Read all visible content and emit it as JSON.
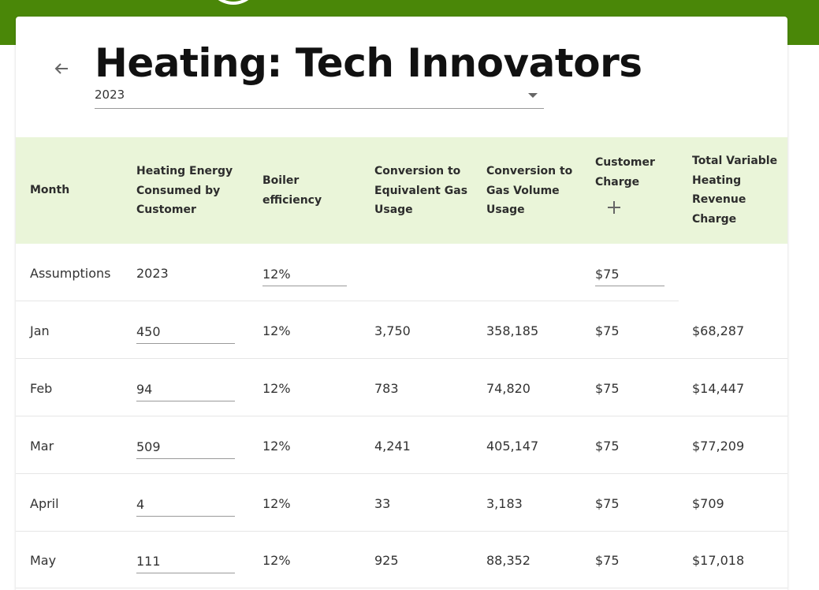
{
  "page": {
    "title": "Heating: Tech Innovators"
  },
  "year_select": {
    "value": "2023"
  },
  "table": {
    "headers": {
      "month": "Month",
      "energy": [
        "Heating Energy",
        "Consumed by",
        "Customer"
      ],
      "boiler": [
        "Boiler",
        "efficiency"
      ],
      "equiv": [
        "Conversion to",
        "Equivalent Gas",
        "Usage"
      ],
      "volume": [
        "Conversion to",
        "Gas Volume",
        "Usage"
      ],
      "charge": [
        "Customer",
        "Charge"
      ],
      "total": [
        "Total Variable",
        "Heating",
        "Revenue",
        "Charge"
      ]
    },
    "assumptions": {
      "label": "Assumptions",
      "year": "2023",
      "boiler": "12%",
      "charge": "$75"
    },
    "rows": [
      {
        "month": "Jan",
        "energy": "450",
        "boiler": "12%",
        "equiv": "3,750",
        "volume": "358,185",
        "charge": "$75",
        "total": "$68,287"
      },
      {
        "month": "Feb",
        "energy": "94",
        "boiler": "12%",
        "equiv": "783",
        "volume": "74,820",
        "charge": "$75",
        "total": "$14,447"
      },
      {
        "month": "Mar",
        "energy": "509",
        "boiler": "12%",
        "equiv": "4,241",
        "volume": "405,147",
        "charge": "$75",
        "total": "$77,209"
      },
      {
        "month": "April",
        "energy": "4",
        "boiler": "12%",
        "equiv": "33",
        "volume": "3,183",
        "charge": "$75",
        "total": "$709"
      },
      {
        "month": "May",
        "energy": "111",
        "boiler": "12%",
        "equiv": "925",
        "volume": "88,352",
        "charge": "$75",
        "total": "$17,018"
      }
    ]
  },
  "colors": {
    "brand_green": "#4a8708",
    "header_bg": "#eaf5d9"
  },
  "icons": {
    "back": "arrow-left-icon",
    "add": "plus-icon",
    "dropdown": "caret-down-icon"
  }
}
